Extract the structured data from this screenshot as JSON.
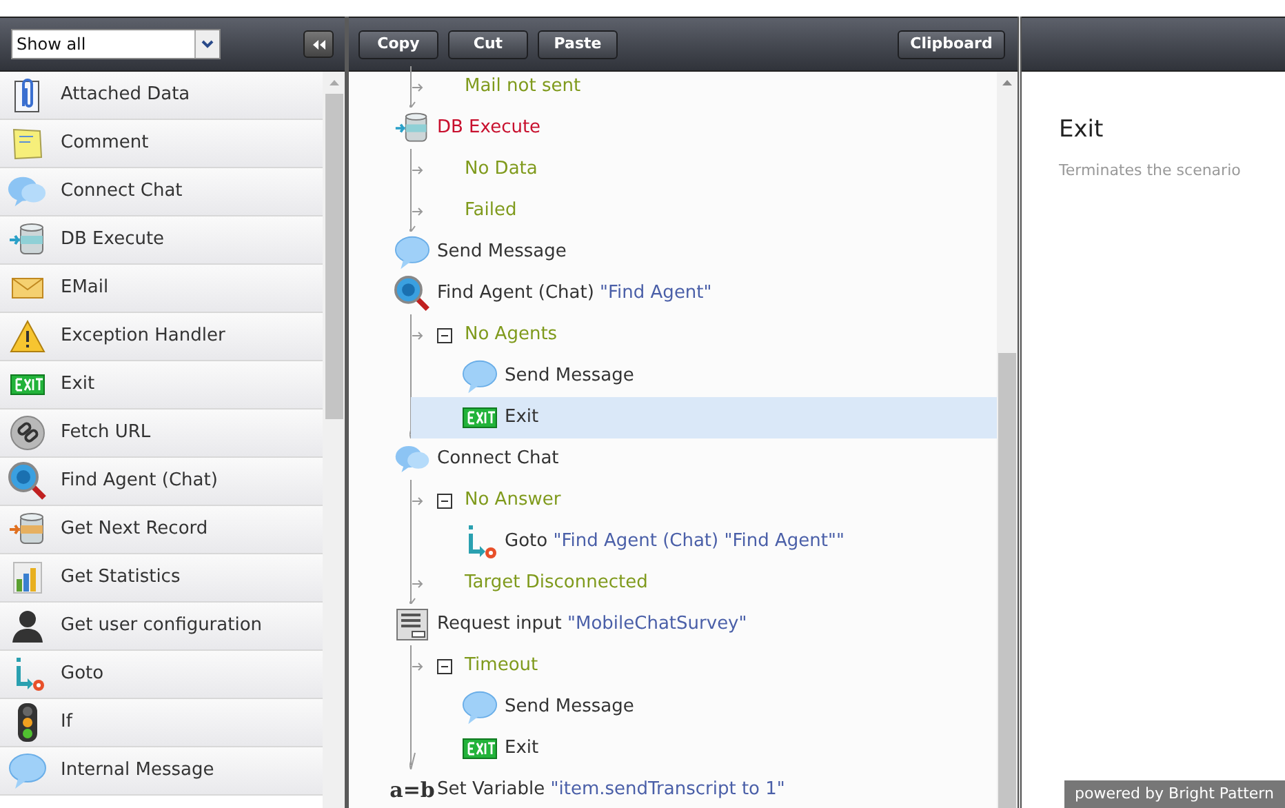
{
  "palette": {
    "filter": {
      "value": "Show all"
    },
    "items": [
      {
        "label": "Attached Data",
        "kind": "clip"
      },
      {
        "label": "Comment",
        "kind": "note"
      },
      {
        "label": "Connect Chat",
        "kind": "chat"
      },
      {
        "label": "DB Execute",
        "kind": "db"
      },
      {
        "label": "EMail",
        "kind": "mail"
      },
      {
        "label": "Exception Handler",
        "kind": "warn"
      },
      {
        "label": "Exit",
        "kind": "exit"
      },
      {
        "label": "Fetch URL",
        "kind": "link"
      },
      {
        "label": "Find Agent (Chat)",
        "kind": "find"
      },
      {
        "label": "Get Next Record",
        "kind": "dbnext"
      },
      {
        "label": "Get Statistics",
        "kind": "stats"
      },
      {
        "label": "Get user configuration",
        "kind": "user"
      },
      {
        "label": "Goto",
        "kind": "goto"
      },
      {
        "label": "If",
        "kind": "light"
      },
      {
        "label": "Internal Message",
        "kind": "bubble"
      }
    ]
  },
  "toolbar": {
    "buttons": [
      "Copy",
      "Cut",
      "Paste"
    ],
    "clipboard": "Clipboard"
  },
  "flow": [
    {
      "kind": "branch",
      "label": "Mail not sent",
      "selected": false
    },
    {
      "kind": "db",
      "label": "DB Execute",
      "error": true,
      "selected": false,
      "children": [
        {
          "kind": "branch",
          "label": "No Data",
          "selected": false
        },
        {
          "kind": "branch",
          "label": "Failed",
          "selected": false
        }
      ]
    },
    {
      "kind": "bubble",
      "label": "Send Message",
      "error": false,
      "selected": false
    },
    {
      "kind": "find",
      "label": "Find Agent (Chat)",
      "argument": "\"Find Agent\"",
      "error": false,
      "selected": false,
      "children": [
        {
          "kind": "branch",
          "label": "No Agents",
          "expanded": true,
          "selected": false,
          "children": [
            {
              "kind": "bubble",
              "label": "Send Message",
              "error": false,
              "selected": false
            },
            {
              "kind": "exit",
              "label": "Exit",
              "error": false,
              "selected": true
            }
          ]
        }
      ]
    },
    {
      "kind": "chat",
      "label": "Connect Chat",
      "error": false,
      "selected": false,
      "children": [
        {
          "kind": "branch",
          "label": "No Answer",
          "expanded": true,
          "selected": false,
          "children": [
            {
              "kind": "goto",
              "label": "Goto",
              "argument": "\"Find Agent (Chat) \"Find Agent\"\"",
              "error": false,
              "selected": false
            }
          ]
        },
        {
          "kind": "branch",
          "label": "Target Disconnected",
          "selected": false
        }
      ]
    },
    {
      "kind": "form",
      "label": "Request input",
      "argument": "\"MobileChatSurvey\"",
      "error": false,
      "selected": false,
      "children": [
        {
          "kind": "branch",
          "label": "Timeout",
          "expanded": true,
          "selected": false,
          "children": [
            {
              "kind": "bubble",
              "label": "Send Message",
              "error": false,
              "selected": false
            },
            {
              "kind": "exit",
              "label": "Exit",
              "error": false,
              "selected": false
            }
          ]
        }
      ]
    },
    {
      "kind": "text",
      "icon_text": "a=b",
      "label": "Set Variable",
      "argument": "\"item.sendTranscript to 1\"",
      "error": false,
      "selected": false
    }
  ],
  "details": {
    "title": "Exit",
    "description": "Terminates the scenario"
  },
  "footer": "powered by Bright Pattern"
}
